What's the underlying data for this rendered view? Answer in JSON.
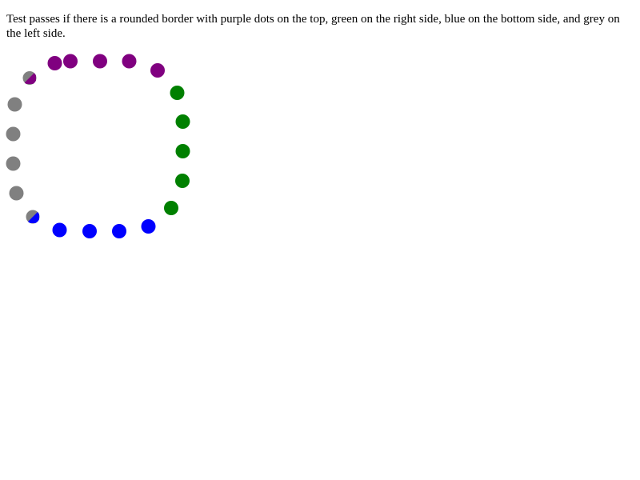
{
  "instructions": "Test passes if there is a rounded border with purple dots on the top, green on the right side, blue on the bottom side, and grey on the left side.",
  "colors": {
    "top": "#800080",
    "right": "#008000",
    "bottom": "#0000ff",
    "left": "#808080"
  }
}
